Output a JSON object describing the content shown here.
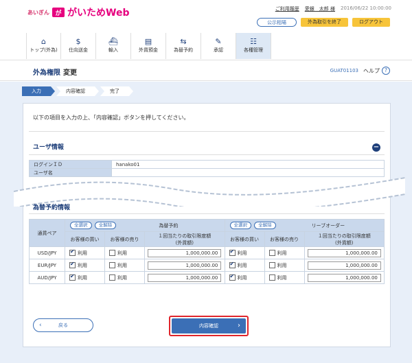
{
  "header": {
    "brand_small": "あいぎん",
    "brand_mark": "が",
    "brand_name": "がいためWeb",
    "links": {
      "help": "ご利用履歴",
      "user": "愛銀　太郎 様",
      "datetime": "2016/06/22 10:00:00"
    },
    "buttons": {
      "rates": "公示相場",
      "end_fx": "外為取引を終了",
      "logout": "ログアウト"
    },
    "nav": [
      {
        "icon": "home-icon",
        "glyph": "⌂",
        "label": "トップ(外為)"
      },
      {
        "icon": "coin-icon",
        "glyph": "$",
        "label": "仕向送金"
      },
      {
        "icon": "ship-icon",
        "glyph": "⛴",
        "label": "輸入"
      },
      {
        "icon": "deposit-icon",
        "glyph": "▤",
        "label": "外貨預金"
      },
      {
        "icon": "exchange-icon",
        "glyph": "⇆",
        "label": "為替予約"
      },
      {
        "icon": "approve-icon",
        "glyph": "✎",
        "label": "承認"
      },
      {
        "icon": "admin-icon",
        "glyph": "☷",
        "label": "各種管理"
      }
    ]
  },
  "title": {
    "main": "外為権限",
    "sub": "変更",
    "screen_id": "GUAT01103",
    "help": "ヘルプ"
  },
  "steps": [
    "入力",
    "内容確認",
    "完了"
  ],
  "instruction": "以下の項目を入力の上、「内容確認」ボタンを押してください。",
  "user_section": {
    "title": "ユーザ情報",
    "rows": [
      {
        "label": "ログインＩＤ",
        "value": "hanako01"
      },
      {
        "label": "ユーザ名",
        "value": ""
      }
    ]
  },
  "fx_section": {
    "title": "為替予約情報",
    "currency_pair_header": "通貨ペア",
    "select_all": "全選択",
    "clear_all": "全解除",
    "group1": "為替予約",
    "group2": "リーブオーダー",
    "col_buy": "お客様の買い",
    "col_sell": "お客様の売り",
    "col_limit_l1": "１回当たりの取引限度額",
    "col_limit_l2": "(外貨額)",
    "use_label": "利用",
    "rows": [
      {
        "pair": "USD/JPY",
        "g1_buy": true,
        "g1_sell": false,
        "g1_limit": "1,000,000.00",
        "g2_buy": true,
        "g2_sell": false,
        "g2_limit": "1,000,000.00"
      },
      {
        "pair": "EUR/JPY",
        "g1_buy": true,
        "g1_sell": false,
        "g1_limit": "1,000,000.00",
        "g2_buy": true,
        "g2_sell": false,
        "g2_limit": "1,000,000.00"
      },
      {
        "pair": "AUD/JPY",
        "g1_buy": true,
        "g1_sell": false,
        "g1_limit": "1,000,000.00",
        "g2_buy": true,
        "g2_sell": false,
        "g2_limit": "1,000,000.00"
      }
    ]
  },
  "actions": {
    "back": "戻る",
    "confirm": "内容確認"
  },
  "colors": {
    "brand": "#e6007e",
    "primary": "#3b6fb6",
    "navy": "#1e3f7a",
    "highlight": "#e0242b"
  }
}
